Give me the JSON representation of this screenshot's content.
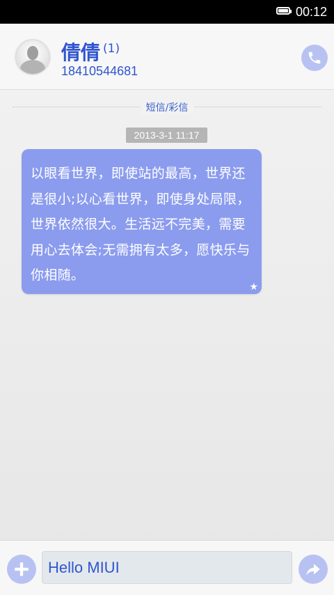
{
  "status_bar": {
    "time": "00:12",
    "battery_icon": "battery-full-icon"
  },
  "header": {
    "contact_name": "倩倩",
    "message_count": "(1)",
    "phone_number": "18410544681",
    "avatar_icon": "person-silhouette-icon",
    "call_icon": "phone-icon"
  },
  "divider": {
    "label": "短信/彩信"
  },
  "conversation": {
    "timestamp": "2013-3-1 11:17",
    "messages": [
      {
        "text": "以眼看世界，即使站的最高，世界还是很小;以心看世界，即使身处局限，世界依然很大。生活远不完美，需要用心去体会;无需拥有太多，愿快乐与你相随。",
        "starred": true,
        "star_icon": "star-icon"
      }
    ]
  },
  "composer": {
    "add_icon": "plus-icon",
    "input_value": "Hello MIUI",
    "send_icon": "send-arrow-icon"
  },
  "colors": {
    "accent": "#2f54d0",
    "bubble": "#8b9cee",
    "button_bg": "#b8c2f2"
  }
}
